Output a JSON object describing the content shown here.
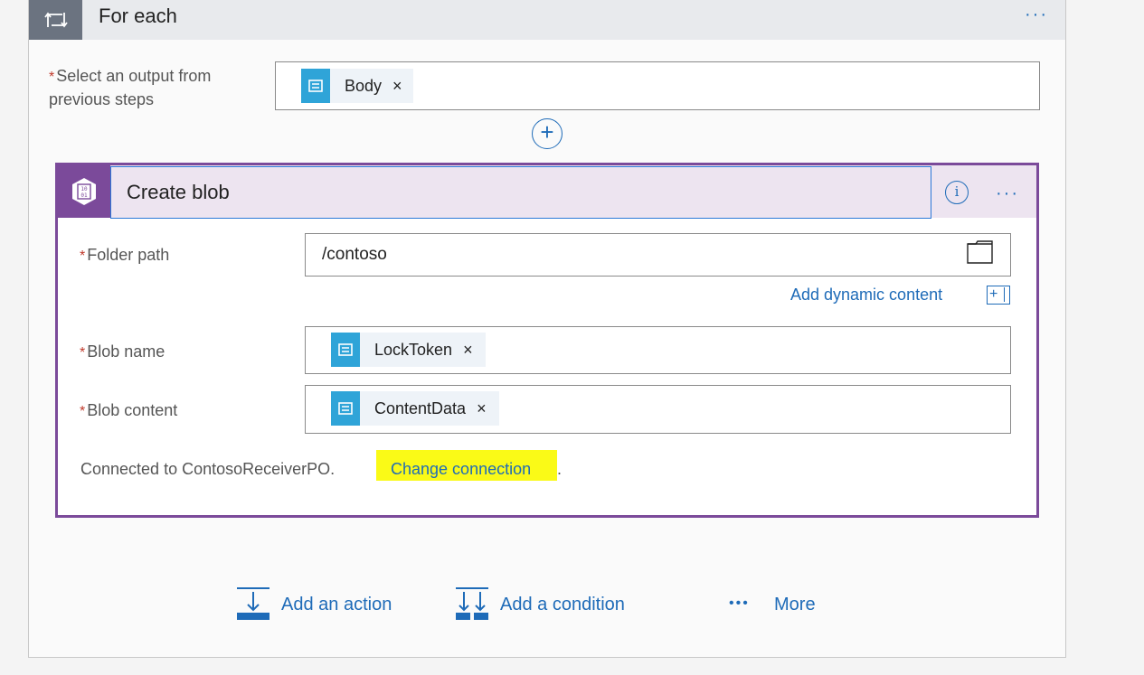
{
  "foreach": {
    "title": "For each",
    "more_label": "···",
    "select_label": "Select an output from previous steps",
    "select_required": "*",
    "token": {
      "label": "Body",
      "remove": "×"
    },
    "add_step": "+"
  },
  "create_blob": {
    "title": "Create blob",
    "icon_text_top": "10",
    "icon_text_bottom": "01",
    "info": "i",
    "more_label": "···",
    "fields": {
      "folder": {
        "required": "*",
        "label": "Folder path",
        "value": "/contoso"
      },
      "blob_name": {
        "required": "*",
        "label": "Blob name",
        "token": "LockToken",
        "remove": "×"
      },
      "blob_content": {
        "required": "*",
        "label": "Blob content",
        "token": "ContentData",
        "remove": "×"
      }
    },
    "dynamic_content_label": "Add dynamic content",
    "dynamic_content_icon": "+",
    "connection": {
      "prefix": "Connected to ContosoReceiverPO.",
      "link": "Change connection",
      "suffix": "."
    }
  },
  "actions": {
    "add_action": "Add an action",
    "add_condition": "Add a condition",
    "more_dots": "•••",
    "more": "More"
  },
  "colors": {
    "accent": "#1e6bb8",
    "blob_purple": "#7b4a9a",
    "token_icon": "#2fa4d8",
    "highlight": "#fafa17",
    "required": "#c0392b"
  }
}
